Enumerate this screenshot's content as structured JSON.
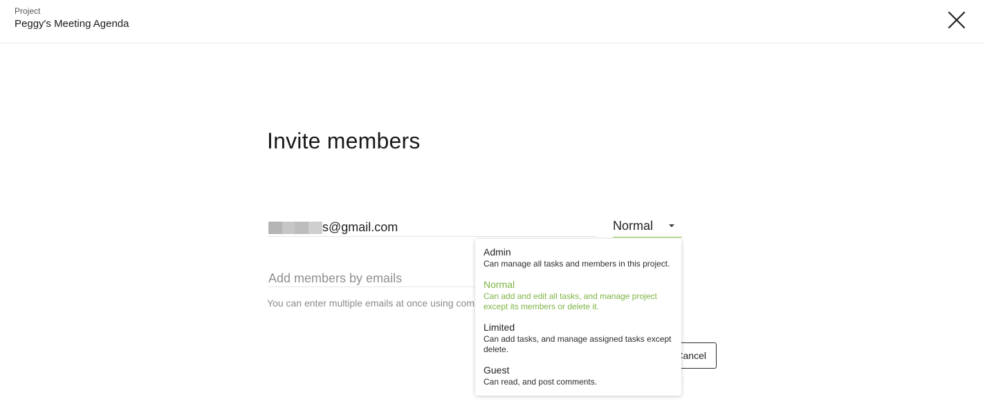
{
  "header": {
    "project_label": "Project",
    "project_title": "Peggy's Meeting Agenda",
    "close_icon": "close-icon"
  },
  "main": {
    "heading": "Invite members",
    "member": {
      "email_suffix": "s@gmail.com",
      "role": "Normal"
    },
    "add_input": {
      "placeholder": "Add members by emails"
    },
    "hint": "You can enter multiple emails at once using comm",
    "cancel_label": "Cancel"
  },
  "role_dropdown": {
    "options": [
      {
        "title": "Admin",
        "description": "Can manage all tasks and members in this project.",
        "selected": false
      },
      {
        "title": "Normal",
        "description": "Can add and edit all tasks, and manage project except its members or delete it.",
        "selected": true
      },
      {
        "title": "Limited",
        "description": "Can add tasks, and manage assigned tasks except delete.",
        "selected": false
      },
      {
        "title": "Guest",
        "description": "Can read, and post comments.",
        "selected": false
      }
    ]
  },
  "colors": {
    "accent": "#8bc34a",
    "selected_text": "#7cb342"
  }
}
